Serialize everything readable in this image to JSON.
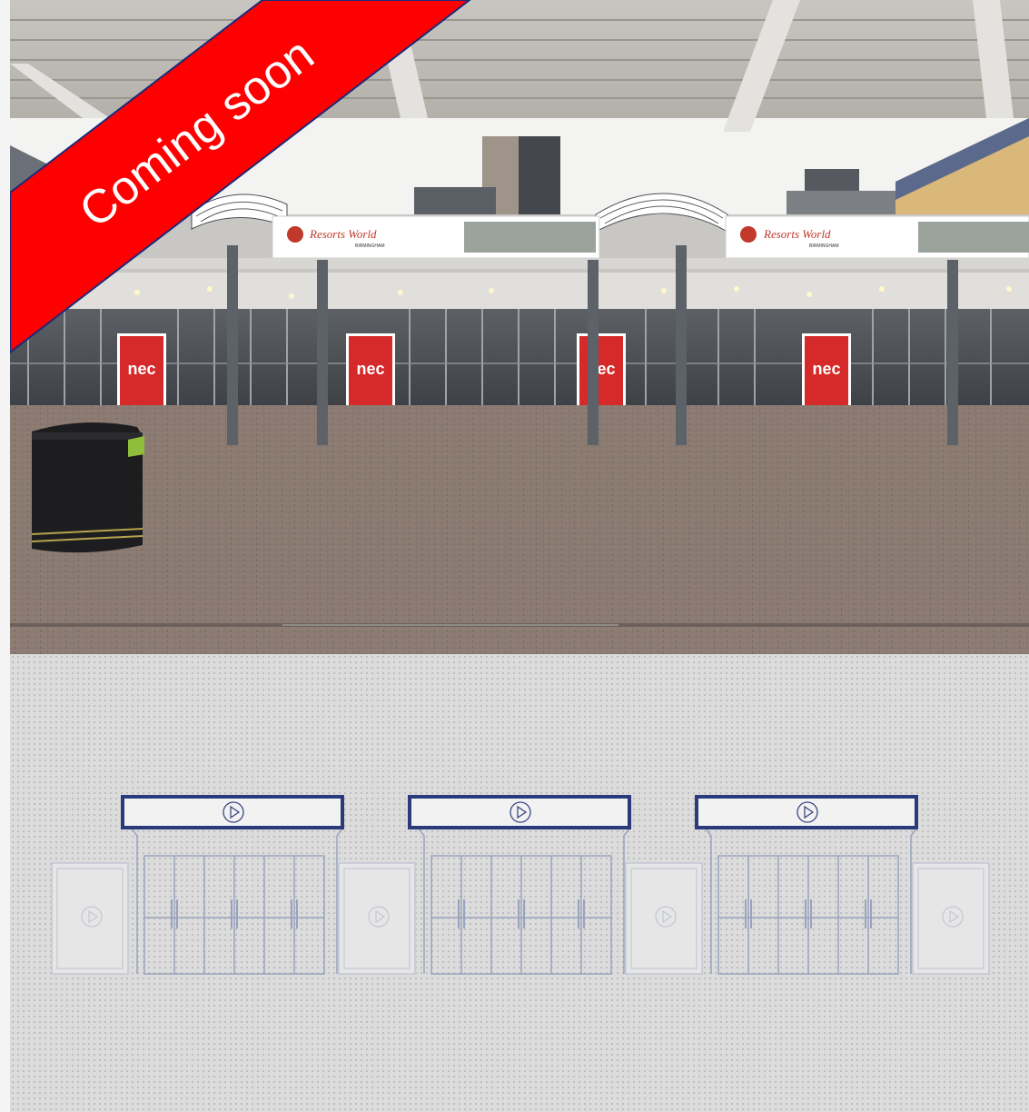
{
  "banner": {
    "text": "Coming soon",
    "color": "#ff0000",
    "text_color": "#ffffff"
  },
  "photo": {
    "sign_brand": "Resorts World",
    "sign_location": "BIRMINGHAM",
    "poster_brand": "nec",
    "poster_color": "#d62a2a"
  },
  "floor_plan": {
    "frame_color": "#2b3a7a",
    "line_color": "#9aa3bd",
    "screens": [
      {
        "type": "canopy-screen",
        "icon": "play-icon"
      },
      {
        "type": "canopy-screen",
        "icon": "play-icon"
      },
      {
        "type": "canopy-screen",
        "icon": "play-icon"
      }
    ],
    "posters": [
      {
        "type": "side-poster",
        "icon": "play-icon"
      },
      {
        "type": "side-poster",
        "icon": "play-icon"
      },
      {
        "type": "side-poster",
        "icon": "play-icon"
      },
      {
        "type": "side-poster",
        "icon": "play-icon"
      }
    ]
  }
}
